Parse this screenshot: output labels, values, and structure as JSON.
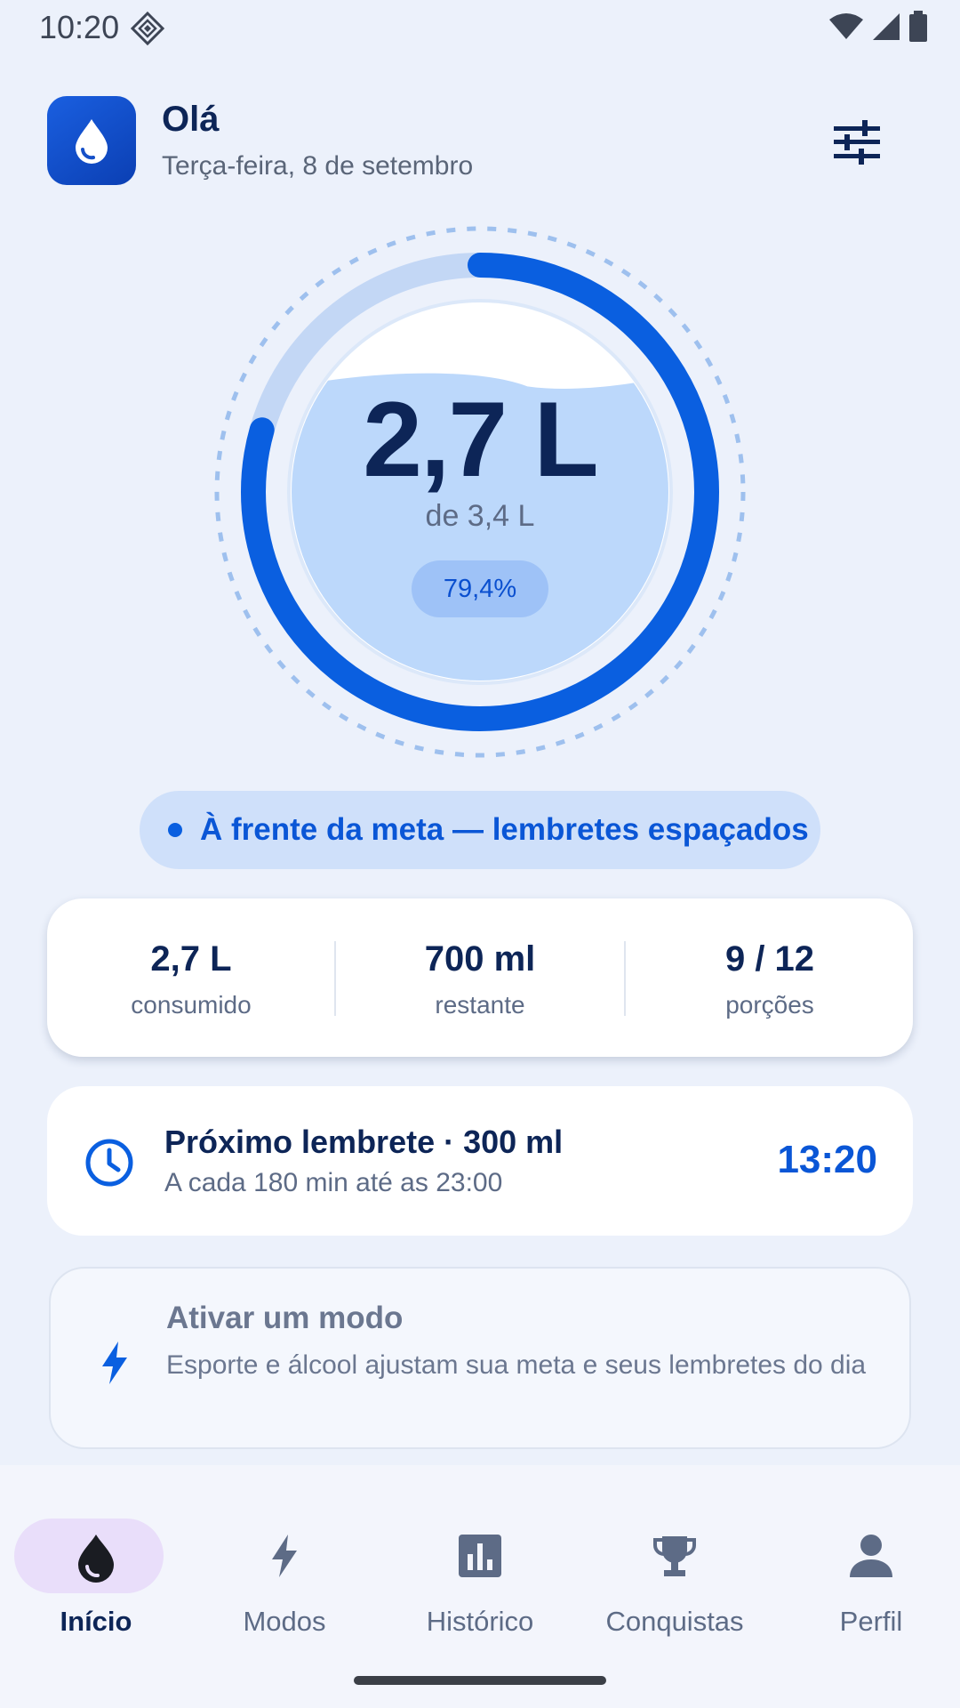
{
  "status_bar": {
    "time": "10:20"
  },
  "header": {
    "greeting": "Olá",
    "date": "Terça-feira, 8 de setembro"
  },
  "intake": {
    "amount": "2,7 L",
    "goal": "de 3,4 L",
    "percent_label": "79,4%",
    "progress_fraction": 0.794
  },
  "status_chip": {
    "text": "À frente da meta — lembretes espaçados"
  },
  "stats": [
    {
      "value": "2,7 L",
      "label": "consumido"
    },
    {
      "value": "700 ml",
      "label": "restante"
    },
    {
      "value": "9 / 12",
      "label": "porções"
    }
  ],
  "reminder": {
    "title": "Próximo lembrete · 300 ml",
    "subtitle": "A cada 180 min até as 23:00",
    "time": "13:20"
  },
  "mode_card": {
    "title": "Ativar um modo",
    "description": "Esporte e álcool ajustam sua meta e seus lembretes do dia"
  },
  "nav": [
    {
      "label": "Início",
      "icon": "water-drop-icon",
      "active": true
    },
    {
      "label": "Modos",
      "icon": "bolt-icon",
      "active": false
    },
    {
      "label": "Histórico",
      "icon": "bar-chart-icon",
      "active": false
    },
    {
      "label": "Conquistas",
      "icon": "trophy-icon",
      "active": false
    },
    {
      "label": "Perfil",
      "icon": "person-icon",
      "active": false
    }
  ],
  "colors": {
    "primary": "#0a5fe0",
    "primary_dark": "#0d2557",
    "track": "#c3d7f5",
    "water": "#bcd8fb",
    "background": "#ecf1fb"
  }
}
